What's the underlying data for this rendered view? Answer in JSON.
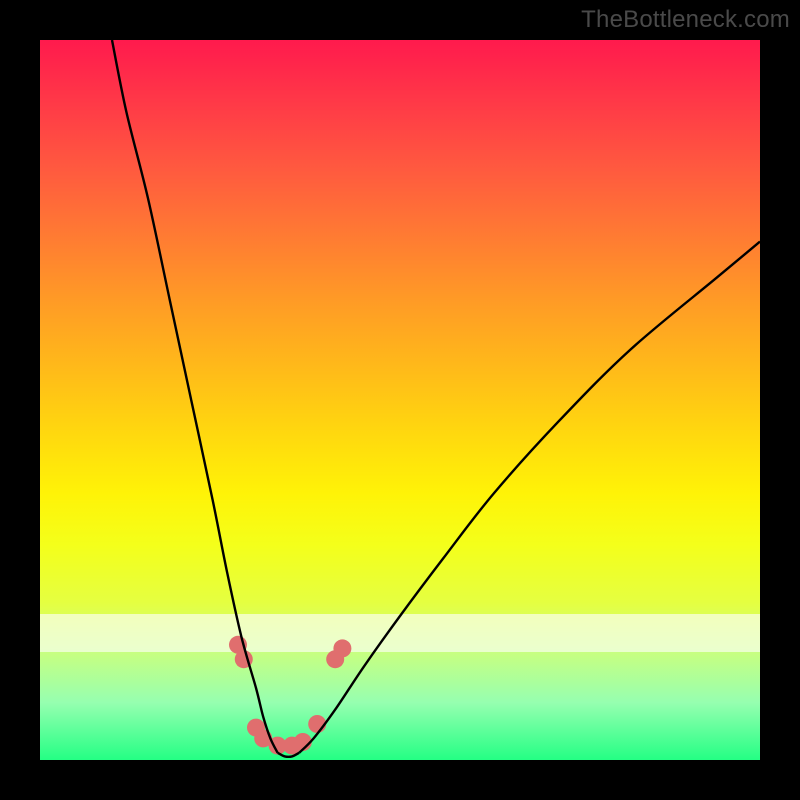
{
  "watermark": "TheBottleneck.com",
  "colors": {
    "frame": "#000000",
    "curve": "#000000",
    "marker": "#e06e6e",
    "gradient_top": "#ff1a4d",
    "gradient_bottom": "#24ff84",
    "white_band": "rgba(255,255,255,0.62)"
  },
  "chart_data": {
    "type": "line",
    "title": "",
    "xlabel": "",
    "ylabel": "",
    "xlim": [
      0,
      100
    ],
    "ylim": [
      0,
      100
    ],
    "grid": false,
    "legend": false,
    "white_band_y": [
      15,
      20
    ],
    "series": [
      {
        "name": "left-curve",
        "x": [
          10,
          12,
          15,
          18,
          21,
          24,
          26,
          28,
          30,
          31,
          32,
          33
        ],
        "y": [
          100,
          90,
          78,
          64,
          50,
          36,
          26,
          17,
          10,
          6,
          3,
          1
        ]
      },
      {
        "name": "right-curve",
        "x": [
          36,
          38,
          41,
          45,
          50,
          56,
          63,
          72,
          82,
          94,
          100
        ],
        "y": [
          1,
          3,
          7,
          13,
          20,
          28,
          37,
          47,
          57,
          67,
          72
        ]
      },
      {
        "name": "valley-floor",
        "x": [
          33,
          34,
          35,
          36
        ],
        "y": [
          1,
          0.5,
          0.5,
          1
        ]
      }
    ],
    "markers": [
      {
        "x": 27.5,
        "y": 16,
        "r": 9
      },
      {
        "x": 28.3,
        "y": 14,
        "r": 9
      },
      {
        "x": 30,
        "y": 4.5,
        "r": 9
      },
      {
        "x": 31,
        "y": 3,
        "r": 9
      },
      {
        "x": 33,
        "y": 2,
        "r": 9
      },
      {
        "x": 35,
        "y": 2,
        "r": 9
      },
      {
        "x": 36.5,
        "y": 2.5,
        "r": 9
      },
      {
        "x": 38.5,
        "y": 5,
        "r": 9
      },
      {
        "x": 41,
        "y": 14,
        "r": 9
      },
      {
        "x": 42,
        "y": 15.5,
        "r": 9
      }
    ]
  }
}
